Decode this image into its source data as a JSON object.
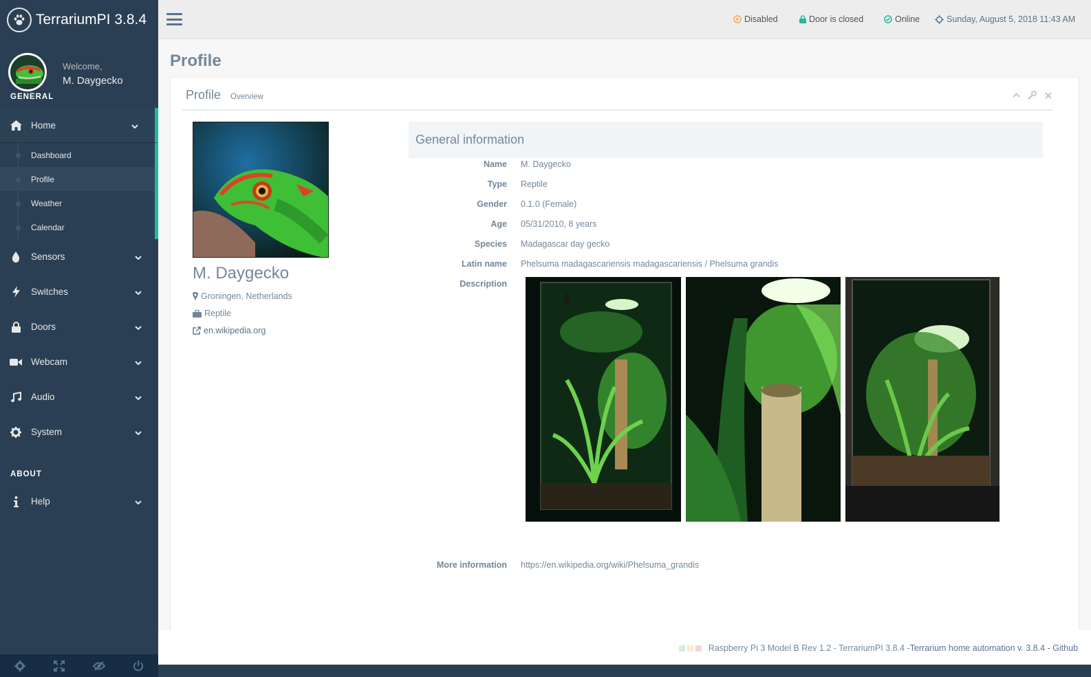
{
  "app": {
    "title": "TerrariumPI 3.8.4",
    "welcome": "Welcome,",
    "user_name": "M. Daygecko"
  },
  "sidebar": {
    "section_general": "GENERAL",
    "section_about": "ABOUT",
    "home": {
      "label": "Home",
      "icon": "home-icon"
    },
    "submenu": [
      {
        "label": "Dashboard"
      },
      {
        "label": "Profile"
      },
      {
        "label": "Weather"
      },
      {
        "label": "Calendar"
      }
    ],
    "items": [
      {
        "label": "Sensors",
        "icon": "drop-icon"
      },
      {
        "label": "Switches",
        "icon": "bolt-icon"
      },
      {
        "label": "Doors",
        "icon": "lock-icon"
      },
      {
        "label": "Webcam",
        "icon": "video-camera-icon"
      },
      {
        "label": "Audio",
        "icon": "music-icon"
      },
      {
        "label": "System",
        "icon": "gear-icon"
      }
    ],
    "help": {
      "label": "Help",
      "icon": "info-icon"
    },
    "footer_icons": [
      "settings-icon",
      "fullscreen-icon",
      "eye-slash-icon",
      "power-icon"
    ]
  },
  "topbar": {
    "status_disabled": "Disabled",
    "status_door": "Door is closed",
    "status_online": "Online",
    "datetime": "Sunday, August 5, 2018 11:43 AM",
    "colors": {
      "disabled": "#f0ad4e",
      "door": "#26b99a",
      "online": "#26b99a"
    }
  },
  "page": {
    "title": "Profile"
  },
  "panel": {
    "title": "Profile",
    "subtitle": "Overview"
  },
  "animal": {
    "name": "M. Daygecko",
    "location": "Groningen, Netherlands",
    "type": "Reptile",
    "link": "en.wikipedia.org"
  },
  "general_info": {
    "title": "General information",
    "labels": {
      "name": "Name",
      "type": "Type",
      "gender": "Gender",
      "age": "Age",
      "species": "Species",
      "latin": "Latin name",
      "description": "Description",
      "more": "More information"
    },
    "values": {
      "name": "M. Daygecko",
      "type": "Reptile",
      "gender": "0.1.0 (Female)",
      "age": "05/31/2010, 8 years",
      "species": "Madagascar day gecko",
      "latin": "Phelsuma madagascariensis madagascariensis / Phelsuma grandis",
      "more": "https://en.wikipedia.org/wiki/Phelsuma_grandis"
    }
  },
  "footer": {
    "text": "Raspberry Pi 3 Model B Rev 1.2 - TerrariumPI 3.8.4 - ",
    "link": "Terrarium home automation v. 3.8.4 - Github"
  }
}
